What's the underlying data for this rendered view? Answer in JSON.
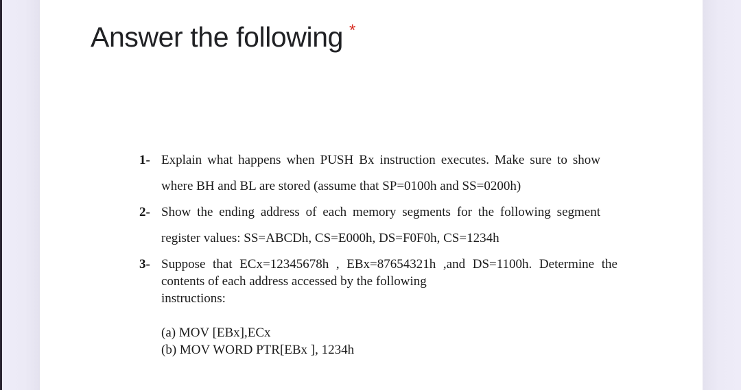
{
  "page": {
    "background_color": "#edebf7",
    "card_color": "#ffffff",
    "rail_color": "#2a2432"
  },
  "question": {
    "title": "Answer the following",
    "required_marker": "*",
    "required_marker_color": "#d93025"
  },
  "body": {
    "items": [
      {
        "marker": "1-",
        "text": "Explain what happens when PUSH Bx instruction executes. Make sure to show where BH and BL are stored (assume that SP=0100h and SS=0200h)"
      },
      {
        "marker": "2-",
        "text": "Show the ending address of each memory  segments for the following segment register values: SS=ABCDh, CS=E000h, DS=F0F0h, CS=1234h"
      },
      {
        "marker": "3-",
        "text": "Suppose that ECx=12345678h , EBx=87654321h ,and DS=1100h. Determine the contents of each address accessed by the following",
        "last_line": "instructions:"
      }
    ],
    "sub_answers": [
      "(a) MOV [EBx],ECx",
      "(b) MOV WORD PTR[EBx ], 1234h"
    ]
  }
}
